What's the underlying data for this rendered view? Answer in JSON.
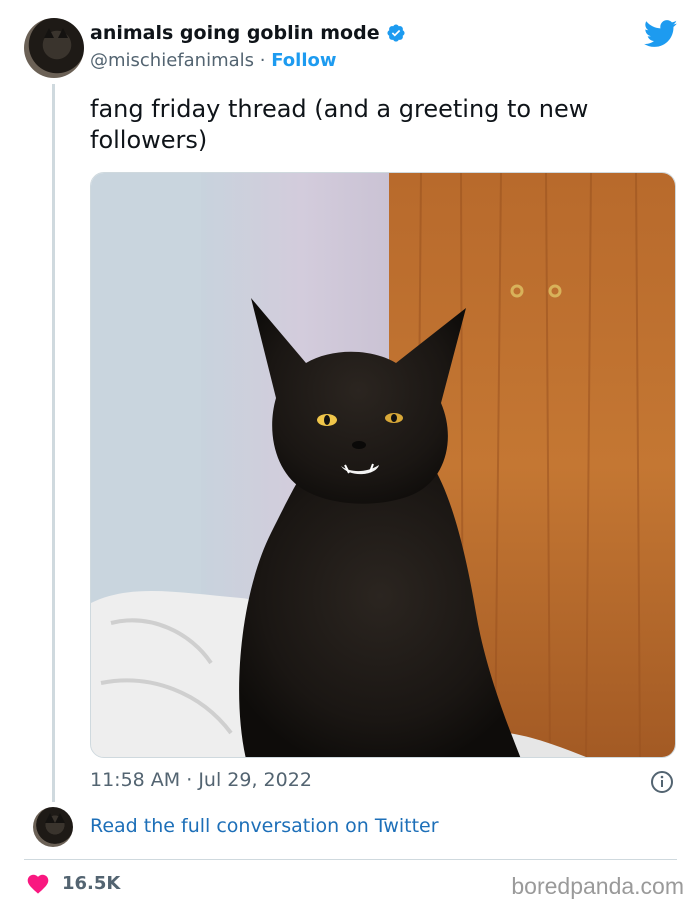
{
  "author": {
    "display_name": "animals going goblin mode",
    "handle": "@mischiefanimals",
    "separator": "·",
    "follow_label": "Follow"
  },
  "tweet": {
    "text": "fang friday thread (and a greeting to new followers)",
    "time": "11:58 AM",
    "separator": "·",
    "date": "Jul 29, 2022"
  },
  "conversation": {
    "link_label": "Read the full conversation on Twitter"
  },
  "engagement": {
    "likes": "16.5K"
  },
  "watermark": "boredpanda.com",
  "colors": {
    "accent": "#1d9bf0",
    "heart": "#f91880",
    "text": "#0f1419",
    "muted": "#536471"
  },
  "icons": [
    "verified-badge-icon",
    "twitter-bird-icon",
    "info-icon",
    "heart-icon"
  ]
}
